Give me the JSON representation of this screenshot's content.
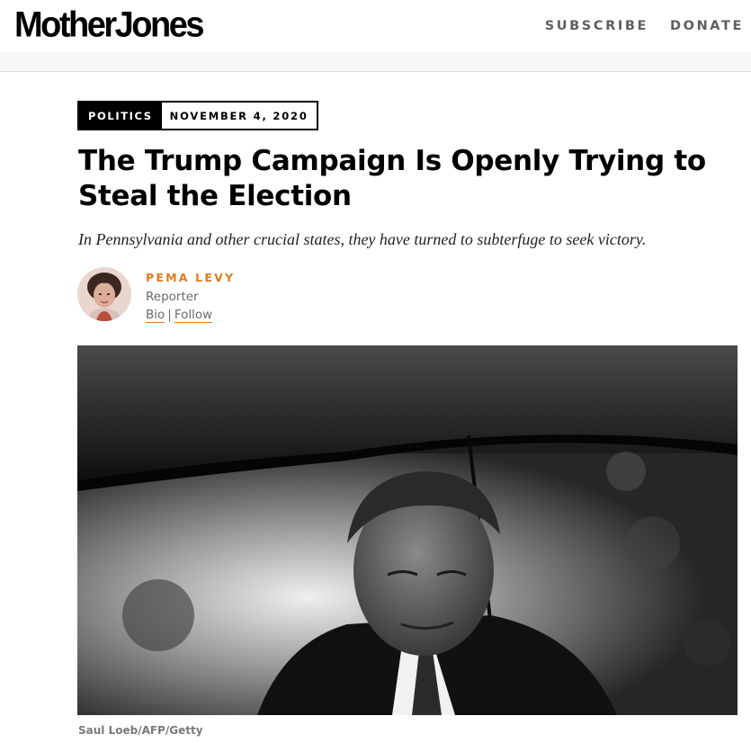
{
  "header": {
    "logo": "MotherJones",
    "nav": {
      "subscribe": "SUBSCRIBE",
      "donate": "DONATE"
    }
  },
  "article": {
    "category": "POLITICS",
    "date": "NOVEMBER 4, 2020",
    "headline": "The Trump Campaign Is Openly Trying to Steal the Election",
    "dek": "In Pennsylvania and other crucial states, they have turned to subterfuge to seek victory.",
    "author": {
      "name": "PEMA LEVY",
      "role": "Reporter",
      "bio_link": "Bio",
      "separator": "|",
      "follow_link": "Follow"
    },
    "photo_credit": "Saul Loeb/AFP/Getty"
  },
  "colors": {
    "accent": "#e07a1e",
    "muted": "#6a6a6a"
  }
}
